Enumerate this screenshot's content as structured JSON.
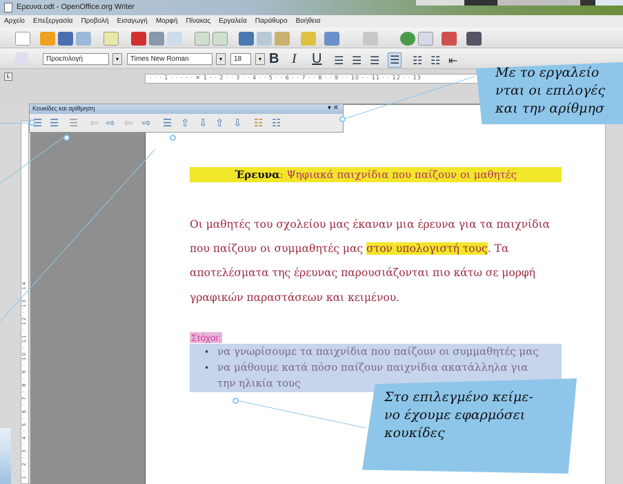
{
  "window": {
    "title": "Ερευνα.odt - OpenOffice.org Writer"
  },
  "menu": [
    "Αρχείο",
    "Επεξεργασία",
    "Προβολή",
    "Εισαγωγή",
    "Μορφή",
    "Πίνακας",
    "Εργαλεία",
    "Παράθυρο",
    "Βοήθεια"
  ],
  "formatting": {
    "paragraph_style": "Προεπιλογή",
    "font_name": "Times New Roman",
    "font_size": "18",
    "bold": "B",
    "italic": "I",
    "underline": "U"
  },
  "ruler": {
    "marks": "· · · 1 · · · · · ✕ 1 · · 2 · · 3 · · 4 · · 5 · · 6 · · 7 · · 8 · · 9 · · 10 · · 11 · · 12 · · 13",
    "vertical_marks": "1 · 2 · 3 · 4 · 5 · 6 · 7 · 8 · 9 · 10 · 11 · 12 · 13 · 14"
  },
  "floating_toolbar": {
    "title": "Κουκίδες και αρίθμηση",
    "close": "▾ ✕"
  },
  "document": {
    "title_bold": "Έρευνα",
    "title_rest": ": Ψηφιακά παιχνίδια που παίζουν οι μαθητές",
    "para1_line1": "Οι μαθητές του σχολείου μας έκαναν μια έρευνα για τα παιχνίδια",
    "para1_line2_a": "που παίζουν οι συμμαθητές μας ",
    "para1_line2_hl": "στον υπολογιστή τους",
    "para1_line2_b": ". Τα",
    "para1_line3": "αποτελέσματα της έρευνας παρουσιάζονται πιο κάτω σε μορφή",
    "para1_line4": "γραφικών παραστάσεων και κειμένου.",
    "goals_heading": "Στόχοι:",
    "bullet1": "να γνωρίσουμε τα παιχνίδια που παίζουν οι συμμαθητές μας",
    "bullet2_line1": "να μάθουμε κατά πόσο παίζουν παιχνίδια ακατάλληλα για",
    "bullet2_line2": "την ηλικία τους"
  },
  "callouts": {
    "top_line1": "Με το εργαλείο",
    "top_line2": "νται οι επιλογές",
    "top_line3": "και την αρίθμησ",
    "bottom_line1": "Στο επιλεγμένο κείμε-",
    "bottom_line2": "νο έχουμε εφαρμόσει",
    "bottom_line3": "κουκίδες"
  },
  "colors": {
    "highlight": "#f2e62a",
    "text_red": "#9c2a3e",
    "callout_blue": "#8ec6ea",
    "selection": "#c6d4ec"
  }
}
